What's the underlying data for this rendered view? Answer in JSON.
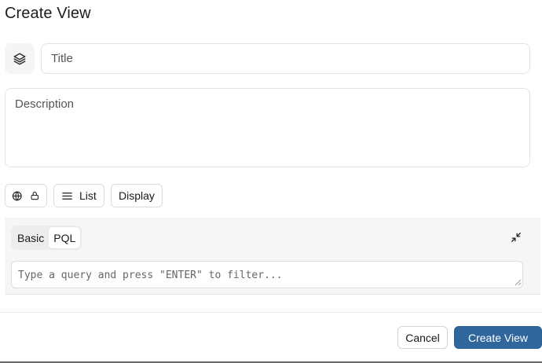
{
  "dialog": {
    "title": "Create View"
  },
  "form": {
    "title_placeholder": "Title",
    "description_placeholder": "Description"
  },
  "toolbar": {
    "visibility_icons": [
      "globe-icon",
      "lock-icon"
    ],
    "layout_label": "List",
    "layout_icon": "list-icon",
    "display_label": "Display"
  },
  "query": {
    "tabs": [
      {
        "label": "Basic",
        "active": false
      },
      {
        "label": "PQL",
        "active": true
      }
    ],
    "placeholder": "Type a query and press \"ENTER\" to filter..."
  },
  "footer": {
    "cancel_label": "Cancel",
    "submit_label": "Create View"
  },
  "colors": {
    "primary": "#2f679c",
    "panel_bg": "#f6f6f6",
    "border": "#e3e3e3"
  }
}
